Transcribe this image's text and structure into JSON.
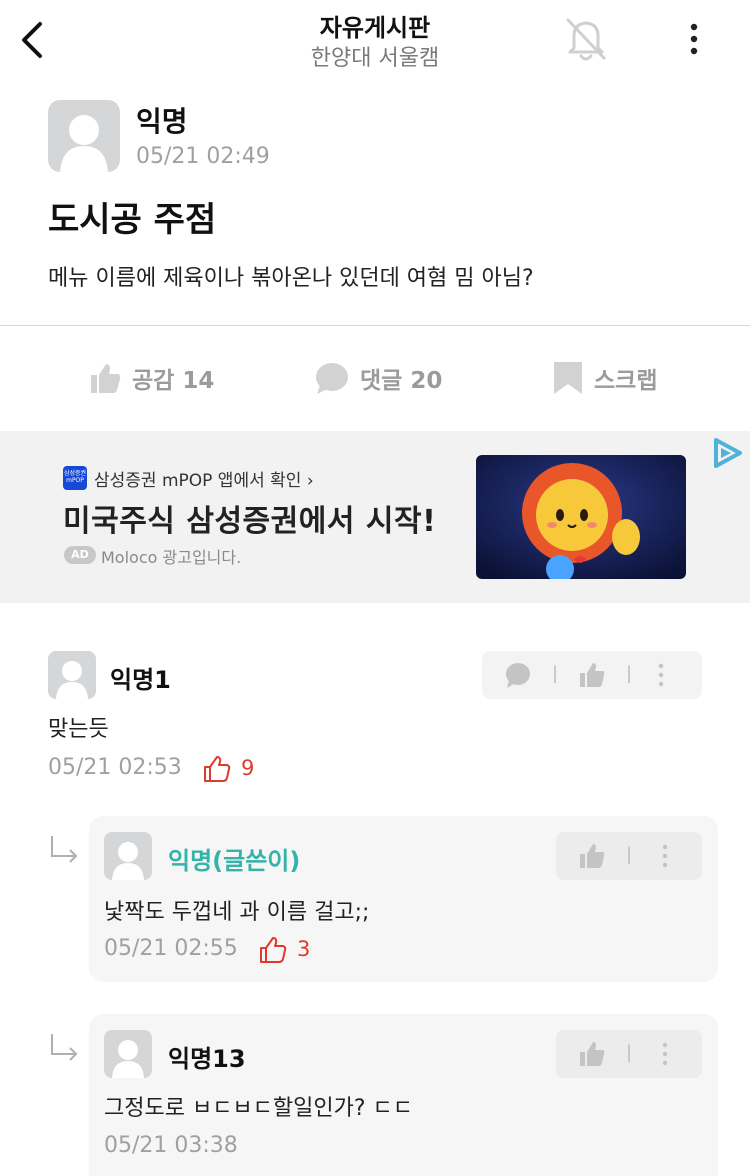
{
  "header": {
    "title": "자유게시판",
    "subtitle": "한양대 서울캠"
  },
  "post": {
    "author": "익명",
    "time": "05/21 02:49",
    "title": "도시공 주점",
    "body": "메뉴 이름에 제육이나 볶아온나 있던데 여혐 밈 아님?"
  },
  "actions": {
    "like_label": "공감 14",
    "comment_label": "댓글 20",
    "scrap_label": "스크랩"
  },
  "ad": {
    "logo_text": "삼성증권 mPOP",
    "source": "삼성증권 mPOP 앱에서 확인 ›",
    "headline": "미국주식 삼성증권에서 시작!",
    "tag": "AD",
    "note": "Moloco 광고입니다."
  },
  "comments": [
    {
      "author": "익명1",
      "body": "맞는듯",
      "time": "05/21 02:53",
      "likes": "9",
      "replies": [
        {
          "author": "익명(글쓴이)",
          "body": "낯짝도 두껍네 과 이름 걸고;;",
          "time": "05/21 02:55",
          "likes": "3"
        },
        {
          "author": "익명13",
          "body": "그정도로 ㅂㄷㅂㄷ할일인가? ㄷㄷ",
          "time": "05/21 03:38"
        }
      ]
    }
  ],
  "colors": {
    "author_highlight": "#34b3a8",
    "likes_red": "#e03a2f",
    "ad_background": "#f2f2f2"
  }
}
